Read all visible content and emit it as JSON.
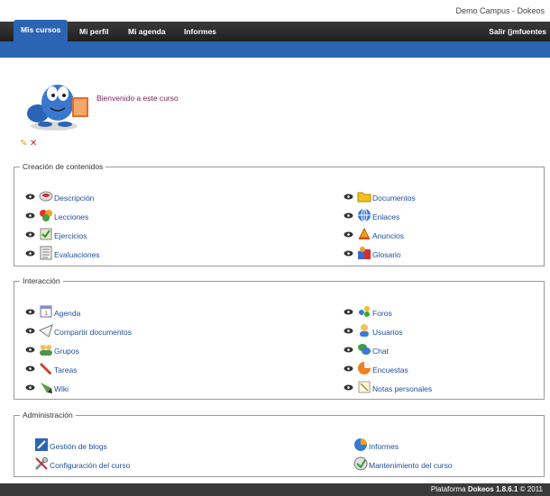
{
  "header": {
    "site_name": "Demo Campus - Dokeos"
  },
  "nav": {
    "tabs": [
      {
        "label": "Mis cursos"
      },
      {
        "label": "Mi perfil"
      },
      {
        "label": "Mi agenda"
      },
      {
        "label": "Informes"
      }
    ],
    "logout": "Salir (jmfuentes"
  },
  "intro": {
    "text": "Bienvenido a este curso"
  },
  "sections": {
    "creacion": {
      "title": "Creación de contenidos",
      "items": [
        "Descripción",
        "Documentos",
        "Lecciones",
        "Enlaces",
        "Ejercicios",
        "Anuncios",
        "Evaluaciones",
        "Glosario"
      ]
    },
    "interaccion": {
      "title": "Interacción",
      "items": [
        "Agenda",
        "Foros",
        "Compartir documentos",
        "Usuarios",
        "Grupos",
        "Chat",
        "Tareas",
        "Encuestas",
        "Wiki",
        "Notas personales"
      ]
    },
    "administracion": {
      "title": "Administración",
      "items": [
        "Gestión de blogs",
        "Informes",
        "Configuración del curso",
        "Mantenimiento del curso"
      ]
    }
  },
  "footer": {
    "prefix": "Plataforma",
    "brand": "Dokeos 1.8.6.1",
    "suffix": "© 2011"
  }
}
